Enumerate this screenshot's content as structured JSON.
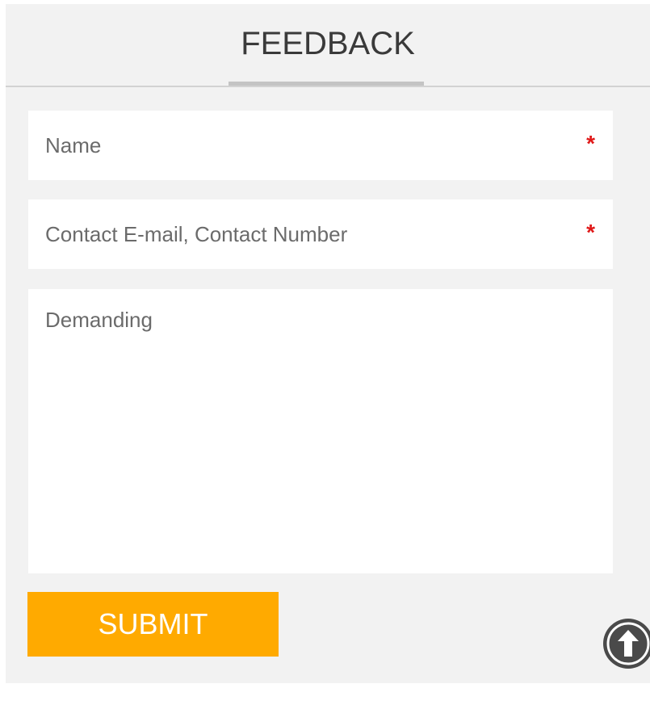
{
  "header": {
    "title": "FEEDBACK"
  },
  "form": {
    "name_placeholder": "Name",
    "contact_placeholder": "Contact E-mail, Contact Number",
    "demand_placeholder": "Demanding",
    "required_mark": "*",
    "submit_label": "SUBMIT"
  },
  "icons": {
    "back_to_top": "arrow-up-circle-icon"
  },
  "colors": {
    "accent": "#ffaa00",
    "required": "#e01818",
    "panel_bg": "#f2f2f2"
  }
}
